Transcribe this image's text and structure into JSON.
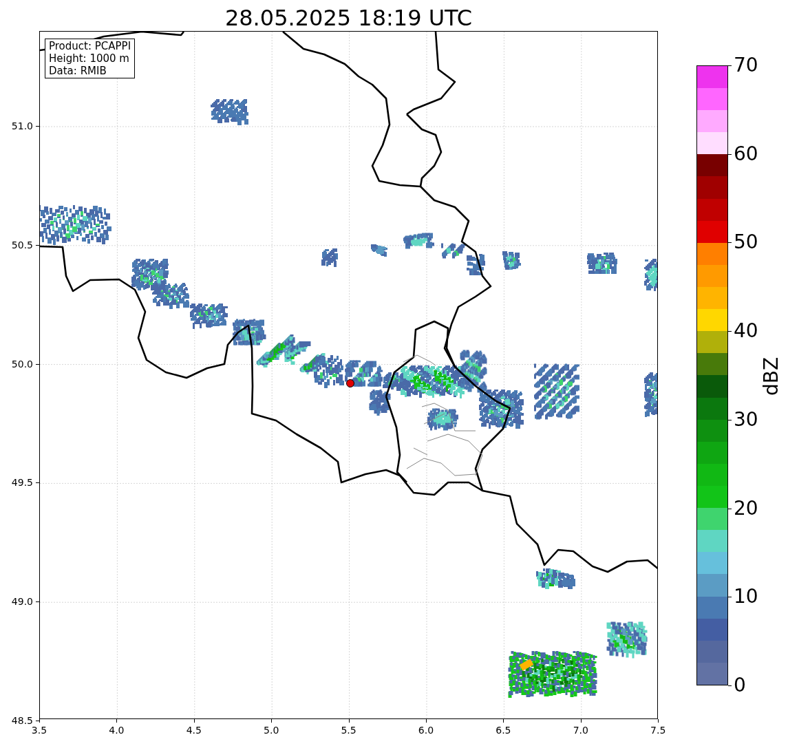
{
  "title": "28.05.2025 18:19 UTC",
  "info_box": [
    "Product: PCAPPI",
    "Height: 1000 m",
    "Data: RMIB"
  ],
  "x_ticks": [
    "3.5",
    "4.0",
    "4.5",
    "5.0",
    "5.5",
    "6.0",
    "6.5",
    "7.0",
    "7.5"
  ],
  "y_ticks": [
    "51.0",
    "50.5",
    "50.0",
    "49.5",
    "49.0",
    "48.5"
  ],
  "colorbar": {
    "label": "dBZ",
    "ticks": [
      "70",
      "60",
      "50",
      "40",
      "30",
      "20",
      "10",
      "0"
    ],
    "bands": [
      {
        "color": "#6272a4"
      },
      {
        "color": "#55689e"
      },
      {
        "color": "#445ea3"
      },
      {
        "color": "#4a7ab2"
      },
      {
        "color": "#5b9cc4"
      },
      {
        "color": "#66c0dc"
      },
      {
        "color": "#5fd6c2"
      },
      {
        "color": "#3fd46e"
      },
      {
        "color": "#12c418"
      },
      {
        "color": "#11b814"
      },
      {
        "color": "#0fa612"
      },
      {
        "color": "#0e9010"
      },
      {
        "color": "#0b780e"
      },
      {
        "color": "#0a5a0a"
      },
      {
        "color": "#487a0a"
      },
      {
        "color": "#b0b00a"
      },
      {
        "color": "#ffd700"
      },
      {
        "color": "#ffb400"
      },
      {
        "color": "#ff9a00"
      },
      {
        "color": "#ff7f00"
      },
      {
        "color": "#e00000"
      },
      {
        "color": "#c00000"
      },
      {
        "color": "#a00000"
      },
      {
        "color": "#780000"
      },
      {
        "color": "#ffddff"
      },
      {
        "color": "#ffaaff"
      },
      {
        "color": "#ff66ff"
      },
      {
        "color": "#ee33ee"
      }
    ]
  }
}
